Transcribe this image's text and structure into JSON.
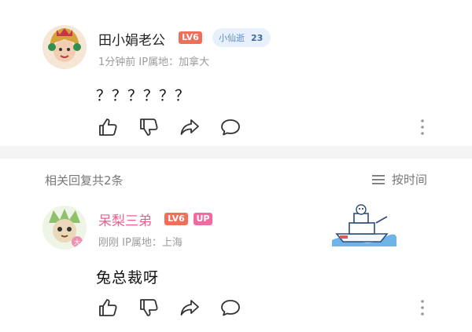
{
  "comment": {
    "username": "田小娟老公",
    "level": "LV6",
    "medal": {
      "name": "小仙逝",
      "level": "23"
    },
    "time": "1分钟前",
    "location": "IP属地：加拿大",
    "text": "？？？？？？",
    "colors": {
      "username": "#222222",
      "level_badge": "#ef6f5b",
      "medal_bg": "#e8f1fb"
    }
  },
  "replies_header": {
    "count_label": "相关回复共2条",
    "sort_label": "按时间"
  },
  "reply": {
    "username": "呆梨三弟",
    "level": "LV6",
    "up_badge": "UP",
    "time": "刚刚",
    "location": "IP属地：上海",
    "text": "兔总裁呀",
    "colors": {
      "username": "#e8628f",
      "up_badge": "#f06aa0"
    }
  },
  "actions": {
    "icons": [
      "thumbs-up-icon",
      "thumbs-down-icon",
      "share-icon",
      "comment-icon",
      "more-icon"
    ]
  }
}
